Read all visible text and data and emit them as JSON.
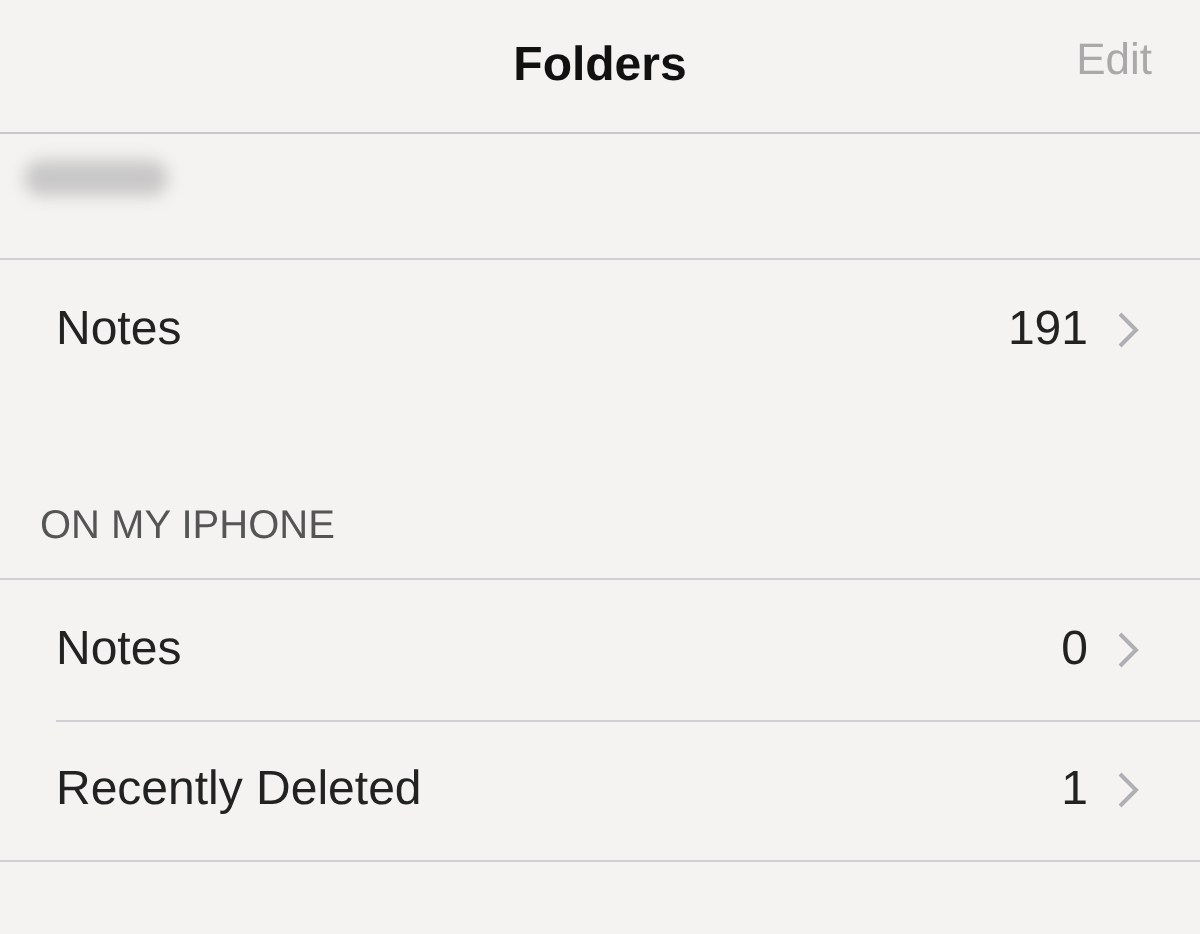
{
  "nav_bar": {
    "title": "Folders",
    "edit_button": {
      "label": "Edit",
      "disabled": true
    }
  },
  "sections": [
    {
      "header_blurred": true,
      "folders": [
        {
          "name": "Notes",
          "count": "191"
        }
      ]
    },
    {
      "header": "ON MY IPHONE",
      "folders": [
        {
          "name": "Notes",
          "count": "0"
        },
        {
          "name": "Recently Deleted",
          "count": "1"
        }
      ]
    }
  ]
}
